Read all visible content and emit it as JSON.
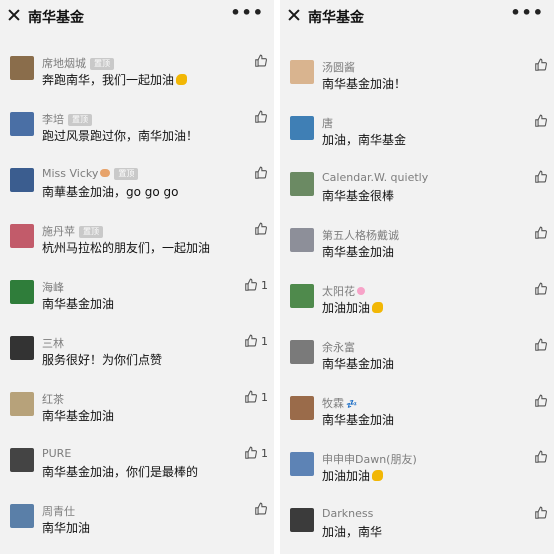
{
  "left": {
    "title": "南华基金",
    "comments": [
      {
        "name": "席地烟城",
        "badge": "置顶",
        "text": "奔跑南华，我们一起加油",
        "emoji": "muscle",
        "likes": "",
        "avatar_color": "#8a6d4b"
      },
      {
        "name": "李培",
        "badge": "置顶",
        "text": "跑过风景跑过你，南华加油！",
        "emoji": "",
        "likes": "",
        "avatar_color": "#4a6fa5"
      },
      {
        "name": "Miss Vicky",
        "badge": "置顶",
        "text": "南華基金加油，go go go",
        "emoji": "hand",
        "likes": "",
        "avatar_color": "#3b5d8f"
      },
      {
        "name": "施丹苹",
        "badge": "置顶",
        "text": "杭州马拉松的朋友们，一起加油",
        "emoji": "",
        "likes": "",
        "avatar_color": "#c25b6a"
      },
      {
        "name": "海峰",
        "badge": "",
        "text": "南华基金加油",
        "emoji": "",
        "likes": "1",
        "avatar_color": "#2f7d3a"
      },
      {
        "name": "三林",
        "badge": "",
        "text": "服务很好！为你们点赞",
        "emoji": "",
        "likes": "1",
        "avatar_color": "#333333"
      },
      {
        "name": "红茶",
        "badge": "",
        "text": "南华基金加油",
        "emoji": "",
        "likes": "1",
        "avatar_color": "#b7a27a"
      },
      {
        "name": "PURE",
        "badge": "",
        "text": "南华基金加油，你们是最棒的",
        "emoji": "",
        "likes": "1",
        "avatar_color": "#444444"
      },
      {
        "name": "周青仕",
        "badge": "",
        "text": "南华加油",
        "emoji": "",
        "likes": "",
        "avatar_color": "#5a7fa8"
      }
    ]
  },
  "right": {
    "title": "南华基金",
    "comments": [
      {
        "name": "汤圆酱",
        "text": "南华基金加油！",
        "emoji": "",
        "likes": "",
        "avatar_color": "#d9b48f"
      },
      {
        "name": "唐",
        "text": "加油，南华基金",
        "emoji": "",
        "likes": "",
        "avatar_color": "#3f7fb5"
      },
      {
        "name": "Calendar.W. quietly",
        "text": "南华基金很棒",
        "emoji": "",
        "likes": "",
        "avatar_color": "#6b8a63"
      },
      {
        "name": "第五人格杨戴诚",
        "text": "南华基金加油",
        "emoji": "",
        "likes": "",
        "avatar_color": "#8d8f99"
      },
      {
        "name": "太阳花",
        "text": "加油加油",
        "emoji": "muscle",
        "name_emoji": "flowers",
        "likes": "",
        "avatar_color": "#4f8a4c"
      },
      {
        "name": "余永富",
        "text": "南华基金加油",
        "emoji": "",
        "likes": "",
        "avatar_color": "#7a7a7a"
      },
      {
        "name": "牧霖",
        "text": "南华基金加油",
        "emoji": "",
        "name_emoji": "zz",
        "likes": "",
        "avatar_color": "#9a6b4a"
      },
      {
        "name": "申申申Dawn(朋友)",
        "text": "加油加油",
        "emoji": "muscle",
        "likes": "",
        "avatar_color": "#5d83b5"
      },
      {
        "name": "Darkness",
        "text": "加油，南华",
        "emoji": "",
        "likes": "",
        "avatar_color": "#3b3b3b"
      }
    ]
  }
}
